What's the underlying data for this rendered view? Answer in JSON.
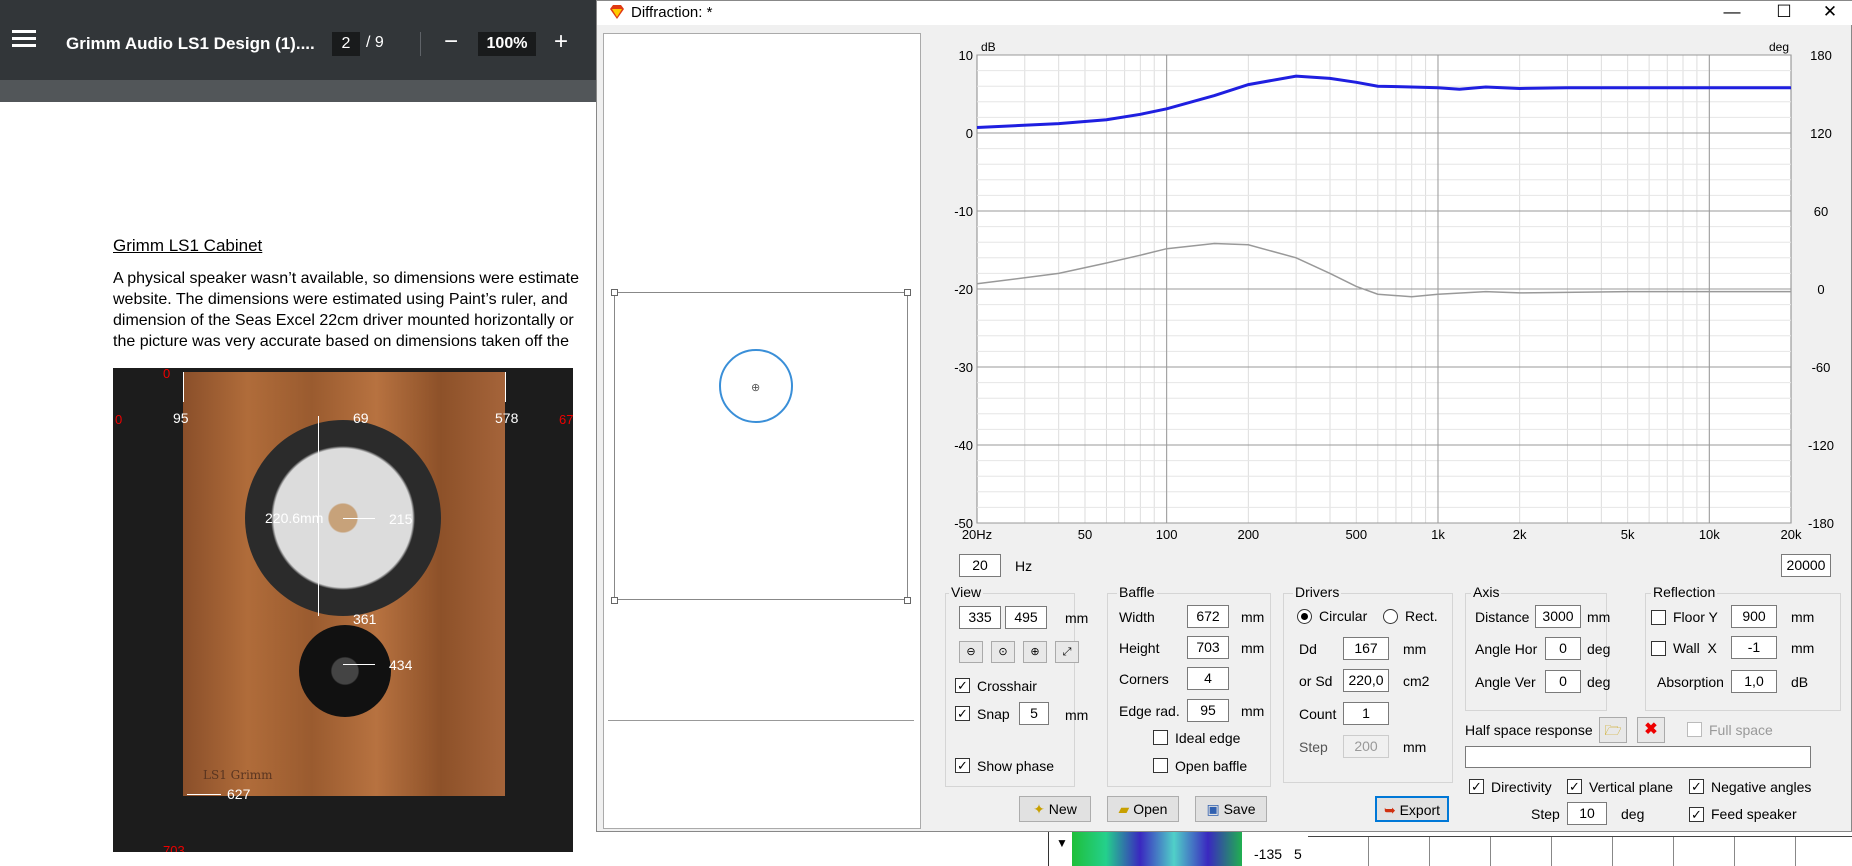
{
  "pdf": {
    "doc_title": "Grimm Audio LS1 Design (1)....",
    "page_current": "2",
    "page_total": "/  9",
    "zoom": "100%",
    "heading": "Grimm LS1 Cabinet",
    "lines": [
      "A physical speaker wasn’t available, so dimensions were estimate",
      "website.  The dimensions were estimated using Paint’s ruler, and",
      "dimension of the Seas Excel 22cm driver mounted horizontally or",
      "the picture was very accurate based on dimensions taken off the"
    ],
    "dims_white": [
      "95",
      "69",
      "578",
      "220.6mm",
      "215",
      "361",
      "434",
      "627"
    ],
    "dims_red": [
      "0",
      "0",
      "672",
      "703"
    ],
    "logo_text": "LS1 Grimm"
  },
  "dialog": {
    "title": "Diffraction: *",
    "minimize": "—",
    "maximize": "☐",
    "close": "✕"
  },
  "chart_data": {
    "type": "line",
    "xscale": "log",
    "xlim": [
      20,
      20000
    ],
    "ylim": [
      -50,
      10
    ],
    "y2lim": [
      -180,
      180
    ],
    "ylabel": "dB",
    "y2label": "deg",
    "xticks": [
      "20Hz",
      "50",
      "100",
      "200",
      "500",
      "1k",
      "2k",
      "5k",
      "10k",
      "20k"
    ],
    "xtick_values": [
      20,
      50,
      100,
      200,
      500,
      1000,
      2000,
      5000,
      10000,
      20000
    ],
    "yticks": [
      "10",
      "0",
      "-10",
      "-20",
      "-30",
      "-40",
      "-50"
    ],
    "y2ticks": [
      "180",
      "120",
      "60",
      "0",
      "-60",
      "-120",
      "-180"
    ],
    "grid": true,
    "series": [
      {
        "color": "#1f1fe0",
        "axis": "left",
        "x": [
          20,
          40,
          60,
          80,
          100,
          150,
          200,
          300,
          400,
          500,
          600,
          800,
          1000,
          1200,
          1500,
          2000,
          3000,
          5000,
          10000,
          20000
        ],
        "y": [
          0.7,
          1.2,
          1.7,
          2.4,
          3.1,
          4.8,
          6.2,
          7.3,
          7.0,
          6.5,
          6.0,
          5.9,
          5.8,
          5.6,
          5.9,
          5.7,
          5.8,
          5.8,
          5.8,
          5.8
        ]
      },
      {
        "color": "#999999",
        "axis": "right",
        "x": [
          20,
          40,
          60,
          80,
          100,
          150,
          200,
          300,
          400,
          500,
          600,
          800,
          1000,
          1500,
          2000,
          5000,
          10000,
          20000
        ],
        "y": [
          4,
          12,
          20,
          26,
          31,
          35,
          34,
          24,
          12,
          2,
          -4,
          -6,
          -4,
          -2,
          -3,
          -2,
          -2,
          -2
        ]
      }
    ]
  },
  "controls": {
    "freq_min": "20",
    "freq_unit": "Hz",
    "freq_max": "20000",
    "view": {
      "label": "View",
      "x": "335",
      "y": "495",
      "unit": "mm",
      "crosshair": "Crosshair",
      "snap": "Snap",
      "snap_val": "5",
      "show_phase": "Show phase"
    },
    "baffle": {
      "label": "Baffle",
      "width_lbl": "Width",
      "width": "672",
      "height_lbl": "Height",
      "height": "703",
      "corners_lbl": "Corners",
      "corners": "4",
      "edge_lbl": "Edge rad.",
      "edge": "95",
      "mm": "mm",
      "ideal_edge": "Ideal edge",
      "open_baffle": "Open baffle"
    },
    "drivers": {
      "label": "Drivers",
      "circular": "Circular",
      "rect": "Rect.",
      "dd_lbl": "Dd",
      "dd": "167",
      "dd_unit": "mm",
      "sd_lbl": "or Sd",
      "sd": "220,0",
      "sd_unit": "cm2",
      "count_lbl": "Count",
      "count": "1",
      "step_lbl": "Step",
      "step": "200",
      "step_unit": "mm"
    },
    "axis": {
      "label": "Axis",
      "dist_lbl": "Distance",
      "dist": "3000",
      "dist_unit": "mm",
      "hor_lbl": "Angle Hor",
      "hor": "0",
      "hor_unit": "deg",
      "ver_lbl": "Angle Ver",
      "ver": "0",
      "ver_unit": "deg"
    },
    "reflection": {
      "label": "Reflection",
      "floor_lbl": "Floor Y",
      "floor": "900",
      "floor_unit": "mm",
      "wall_lbl": "Wall  X",
      "wall": "-1",
      "wall_unit": "mm",
      "abs_lbl": "Absorption",
      "abs": "1,0",
      "abs_unit": "dB"
    },
    "half_space": "Half space response",
    "full_space": "Full space",
    "directivity": "Directivity",
    "vertical_plane": "Vertical plane",
    "negative_angles": "Negative angles",
    "step_lbl": "Step",
    "step": "10",
    "step_unit": "deg",
    "feed_speaker": "Feed speaker",
    "new_btn": "New",
    "open_btn": "Open",
    "save_btn": "Save",
    "export_btn": "Export"
  },
  "background": {
    "label_135": "-135",
    "label_5": "5"
  }
}
